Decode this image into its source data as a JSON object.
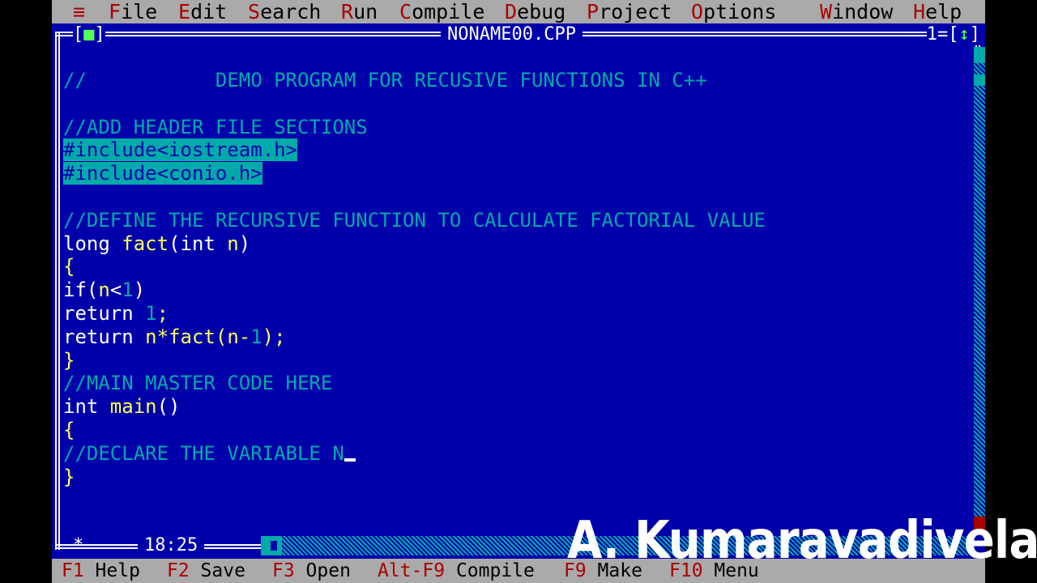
{
  "menubar": {
    "system": "≡",
    "items": [
      {
        "hot": "F",
        "rest": "ile"
      },
      {
        "hot": "E",
        "rest": "dit"
      },
      {
        "hot": "S",
        "rest": "earch"
      },
      {
        "hot": "R",
        "rest": "un"
      },
      {
        "hot": "C",
        "rest": "ompile"
      },
      {
        "hot": "D",
        "rest": "ebug"
      },
      {
        "hot": "P",
        "rest": "roject"
      },
      {
        "hot": "O",
        "rest": "ptions"
      },
      {
        "hot": "W",
        "rest": "indow"
      },
      {
        "hot": "H",
        "rest": "elp"
      }
    ]
  },
  "window": {
    "title": "NONAME00.CPP",
    "close_box_left": "[",
    "close_box_mark": "■",
    "close_box_right": "]",
    "number": "1=[",
    "zoom_arrow": "↕",
    "zoom_close": "]"
  },
  "code": {
    "l1": "//           DEMO PROGRAM FOR RECUSIVE FUNCTIONS IN C++",
    "l3": "//ADD HEADER FILE SECTIONS",
    "l4": "#include<iostream.h>",
    "l5": "#include<conio.h>",
    "l7": "//DEFINE THE RECURSIVE FUNCTION TO CALCULATE FACTORIAL VALUE",
    "l8a": "long ",
    "l8b": "fact",
    "l8c": "(int ",
    "l8d": "n",
    "l8e": ")",
    "l9": "{",
    "l10a": "if(",
    "l10b": "n",
    "l10c": "<",
    "l10d": "1",
    "l10e": ")",
    "l11a": "return ",
    "l11b": "1",
    "l11c": ";",
    "l12a": "return ",
    "l12b": "n",
    "l12c": "*",
    "l12d": "fact",
    "l12e": "(",
    "l12f": "n",
    "l12g": "-",
    "l12h": "1",
    "l12i": ");",
    "l13": "}",
    "l14": "//MAIN MASTER CODE HERE",
    "l15a": "int ",
    "l15b": "main",
    "l15c": "()",
    "l16": "{",
    "l17": "//DECLARE THE VARIABLE N",
    "l18": "}"
  },
  "position": "18:25",
  "status_indicator": "*",
  "statusbar": {
    "items": [
      {
        "key": "F1",
        "label": " Help"
      },
      {
        "key": "F2",
        "label": " Save"
      },
      {
        "key": "F3",
        "label": " Open"
      },
      {
        "key": "Alt-F9",
        "label": " Compile"
      },
      {
        "key": "F9",
        "label": " Make"
      },
      {
        "key": "F10",
        "label": " Menu"
      }
    ]
  },
  "watermark": "A. Kumaravadivelan",
  "colors": {
    "background": "#0000aa",
    "menu": "#aaaaaa",
    "hotkey": "#aa0000",
    "comment": "#00aaaa",
    "identifier": "#ffff55"
  }
}
